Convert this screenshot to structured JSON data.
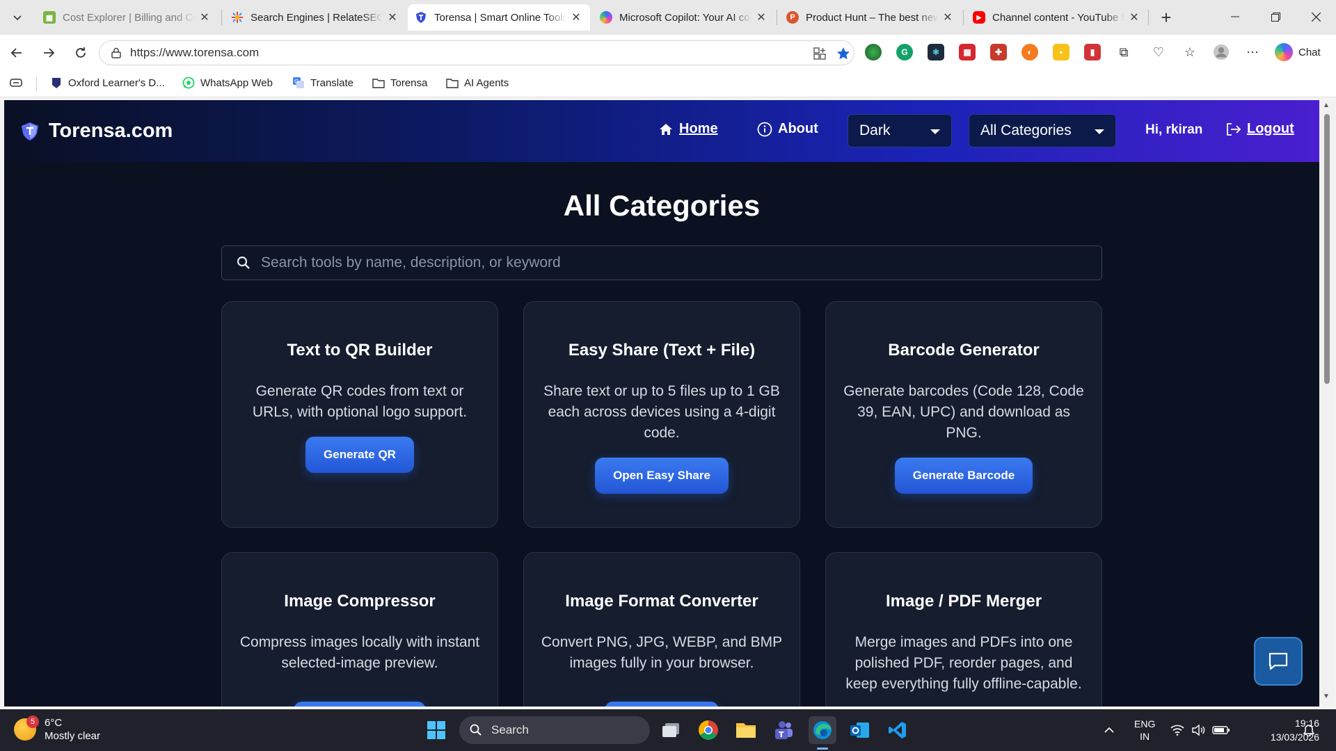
{
  "browser": {
    "tabs": [
      {
        "title": "Cost Explorer | Billing and Cost",
        "icon": "sheet-icon",
        "color": "#7cb342"
      },
      {
        "title": "Search Engines | RelateSEO",
        "icon": "spark-icon",
        "color": "#f4b400"
      },
      {
        "title": "Torensa | Smart Online Tools for",
        "icon": "shield-icon",
        "color": "#3b4fd6"
      },
      {
        "title": "Microsoft Copilot: Your AI com",
        "icon": "copilot-icon",
        "color": "#8a4df0"
      },
      {
        "title": "Product Hunt – The best new p",
        "icon": "producthunt-icon",
        "color": "#da552f"
      },
      {
        "title": "Channel content - YouTube Stu",
        "icon": "youtube-icon",
        "color": "#ff0000"
      }
    ],
    "address": {
      "url": "https://www.torensa.com"
    },
    "chat_label": "Chat",
    "bookmarks": [
      {
        "label": "Oxford Learner's D...",
        "icon": "oxford-icon"
      },
      {
        "label": "WhatsApp Web",
        "icon": "whatsapp-icon"
      },
      {
        "label": "Translate",
        "icon": "translate-icon"
      },
      {
        "label": "Torensa",
        "icon": "folder-icon"
      },
      {
        "label": "AI Agents",
        "icon": "folder-icon"
      }
    ]
  },
  "site": {
    "brand": "Torensa.com",
    "nav": {
      "home": "Home",
      "about": "About",
      "theme_select": "Dark",
      "category_select": "All Categories",
      "greeting": "Hi, rkiran",
      "logout": "Logout"
    },
    "page_title": "All Categories",
    "search_placeholder": "Search tools by name, description, or keyword",
    "cards": [
      {
        "title": "Text to QR Builder",
        "description": "Generate QR codes from text or URLs, with optional logo support.",
        "button": "Generate QR"
      },
      {
        "title": "Easy Share (Text + File)",
        "description": "Share text or up to 5 files up to 1 GB each across devices using a 4-digit code.",
        "button": "Open Easy Share"
      },
      {
        "title": "Barcode Generator",
        "description": "Generate barcodes (Code 128, Code 39, EAN, UPC) and download as PNG.",
        "button": "Generate Barcode"
      },
      {
        "title": "Image Compressor",
        "description": "Compress images locally with instant selected-image preview.",
        "button": ""
      },
      {
        "title": "Image Format Converter",
        "description": "Convert PNG, JPG, WEBP, and BMP images fully in your browser.",
        "button": ""
      },
      {
        "title": "Image / PDF Merger",
        "description": "Merge images and PDFs into one polished PDF, reorder pages, and keep everything fully offline-capable.",
        "button": ""
      }
    ],
    "colors": {
      "accent": "#2f6be6",
      "background": "#0b1120",
      "card": "#151d2e"
    }
  },
  "taskbar": {
    "weather_temp": "6°C",
    "weather_desc": "Mostly clear",
    "weather_badge": "5",
    "search_label": "Search",
    "lang_top": "ENG",
    "lang_bottom": "IN",
    "time": "19:16",
    "date": "13/03/2026"
  }
}
